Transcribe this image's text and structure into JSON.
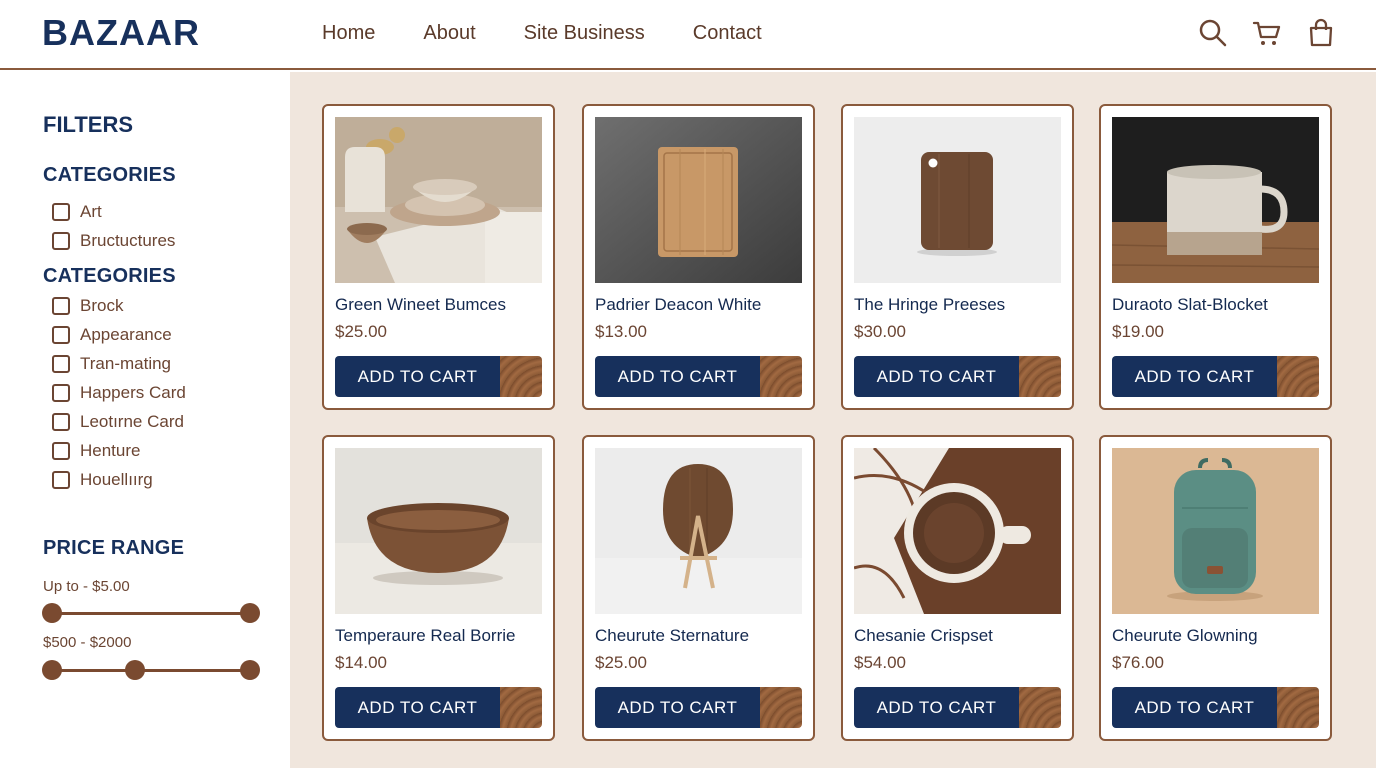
{
  "header": {
    "logo": "BAZAAR",
    "nav": [
      "Home",
      "About",
      "Site Business",
      "Contact"
    ],
    "icons": [
      "search-icon",
      "cart-icon",
      "bag-icon"
    ]
  },
  "sidebar": {
    "title": "FILTERS",
    "group1": {
      "heading": "CATEGORIES",
      "items": [
        "Art",
        "Bructuctures"
      ]
    },
    "group2": {
      "heading": "CATEGORIES",
      "items": [
        "Brock",
        "Appearance",
        "Tran-mating",
        "Happers Card",
        "Leotırne Card",
        "Henture",
        "Houellıırg"
      ]
    },
    "price": {
      "heading": "PRICE RANGE",
      "range1_label": "Up to - $5.00",
      "range2_label": "$500 - $2000"
    }
  },
  "products": [
    {
      "name": "Green Wineet Bumces",
      "price": "$25.00",
      "button": "ADD TO CART",
      "image": "ceramic-bowls"
    },
    {
      "name": "Padrier Deacon White",
      "price": "$13.00",
      "button": "ADD TO CART",
      "image": "cutting-board"
    },
    {
      "name": "The Hringe Preeses",
      "price": "$30.00",
      "button": "ADD TO CART",
      "image": "small-wood-board"
    },
    {
      "name": "Duraoto Slat-Blocket",
      "price": "$19.00",
      "button": "ADD TO CART",
      "image": "ceramic-mug"
    },
    {
      "name": "Temperaure Real Borrie",
      "price": "$14.00",
      "button": "ADD TO CART",
      "image": "wooden-bowl"
    },
    {
      "name": "Cheurute Sternature",
      "price": "$25.00",
      "button": "ADD TO CART",
      "image": "paddle-on-stand"
    },
    {
      "name": "Chesanie Crispset",
      "price": "$54.00",
      "button": "ADD TO CART",
      "image": "cup-top-view"
    },
    {
      "name": "Cheurute Glowning",
      "price": "$76.00",
      "button": "ADD TO CART",
      "image": "green-backpack"
    }
  ],
  "colors": {
    "navy": "#17305c",
    "brown": "#8a5a3c",
    "background": "#f0e6dd"
  }
}
